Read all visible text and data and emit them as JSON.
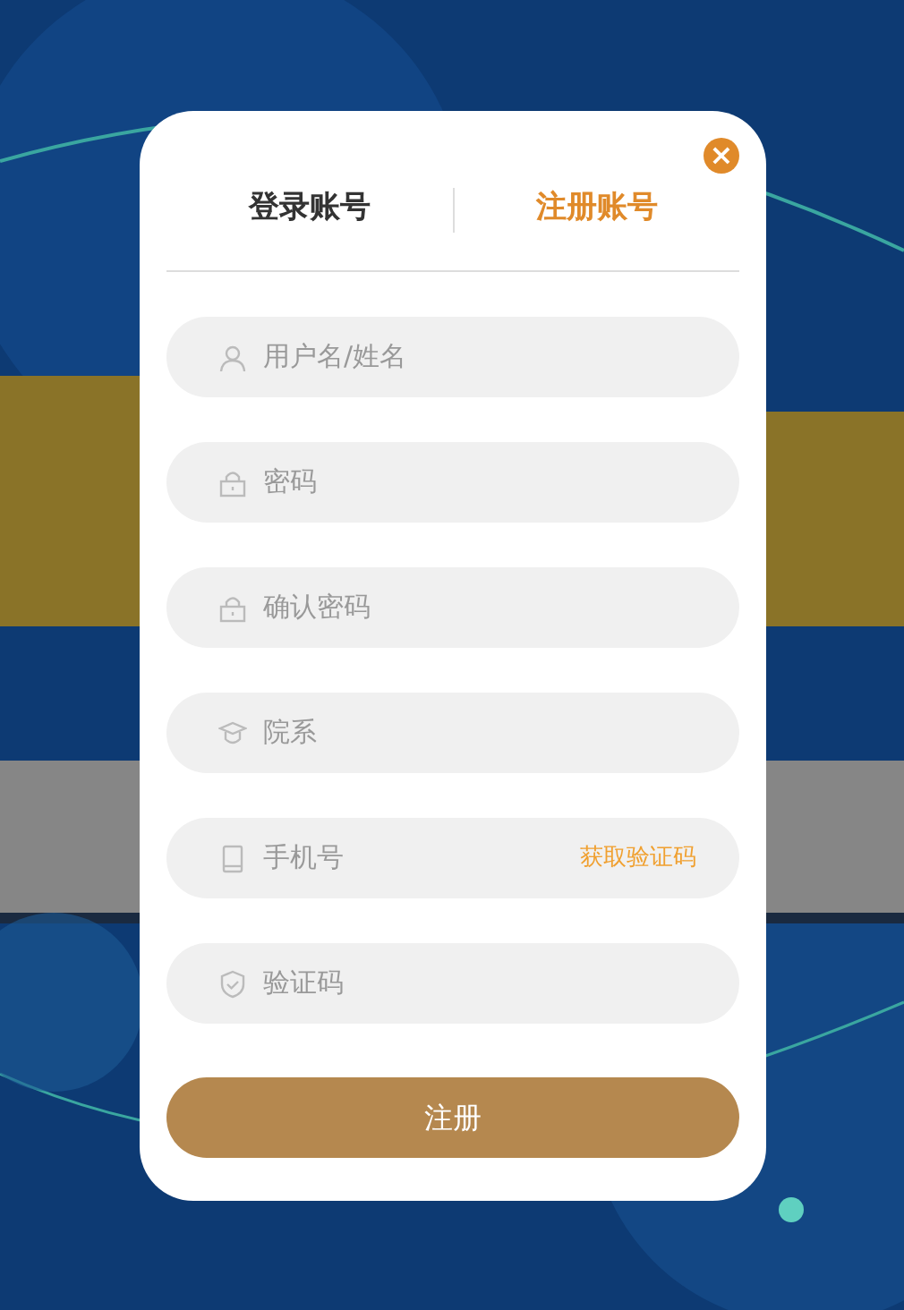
{
  "dialog": {
    "close_label": "×",
    "tabs": [
      {
        "label": "登录账号",
        "selected": false
      },
      {
        "label": "注册账号",
        "selected": true
      }
    ],
    "fields": [
      {
        "kind": "user",
        "placeholder": "用户名/姓名"
      },
      {
        "kind": "lock",
        "placeholder": "密码"
      },
      {
        "kind": "lock",
        "placeholder": "确认密码"
      },
      {
        "kind": "school",
        "placeholder": "院系"
      },
      {
        "kind": "phone",
        "placeholder": "手机号",
        "action": "获取验证码"
      },
      {
        "kind": "shield",
        "placeholder": "验证码"
      }
    ],
    "submit": "注册"
  }
}
